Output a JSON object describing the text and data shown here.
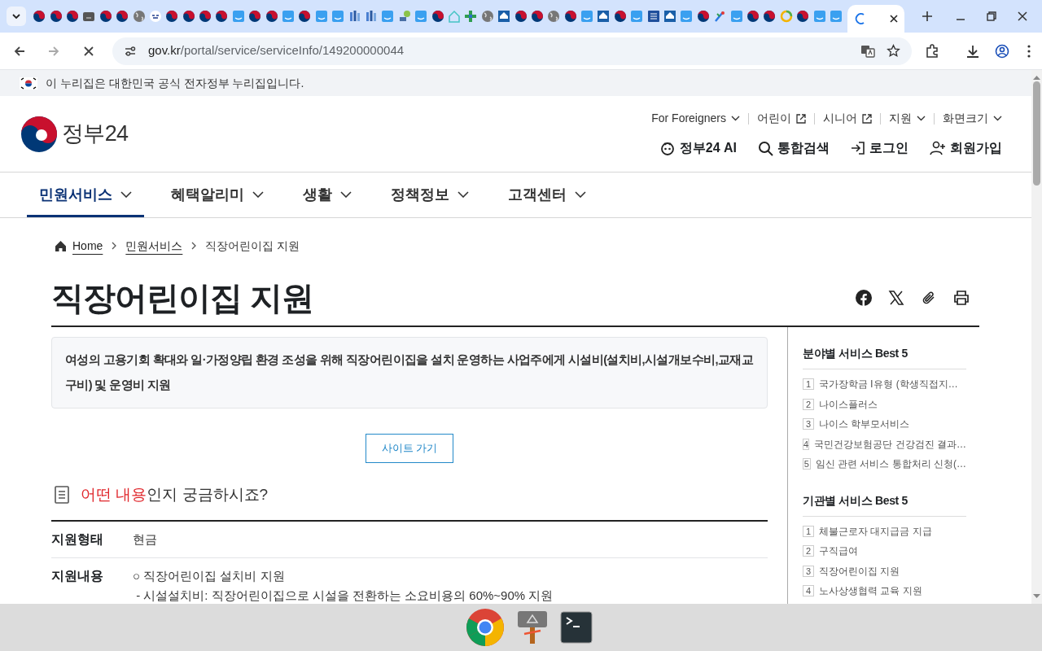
{
  "browser": {
    "tabs": [
      {
        "kind": "taegeuk",
        "selected": false
      },
      {
        "kind": "taegeuk",
        "selected": false
      },
      {
        "kind": "taegeuk",
        "selected": false
      },
      {
        "kind": "folder",
        "selected": false
      },
      {
        "kind": "taegeuk",
        "selected": false
      },
      {
        "kind": "taegeuk",
        "selected": false
      },
      {
        "kind": "globe",
        "selected": false
      },
      {
        "kind": "badge",
        "selected": false
      },
      {
        "kind": "taegeuk",
        "selected": false
      },
      {
        "kind": "taegeuk",
        "selected": false
      },
      {
        "kind": "taegeuk",
        "selected": false
      },
      {
        "kind": "taegeuk",
        "selected": false
      },
      {
        "kind": "blue",
        "selected": false
      },
      {
        "kind": "taegeuk",
        "selected": false
      },
      {
        "kind": "taegeuk",
        "selected": false
      },
      {
        "kind": "blue",
        "selected": false
      },
      {
        "kind": "taegeuk",
        "selected": false
      },
      {
        "kind": "blue",
        "selected": false
      },
      {
        "kind": "blue",
        "selected": false
      },
      {
        "kind": "building",
        "selected": false
      },
      {
        "kind": "building",
        "selected": false
      },
      {
        "kind": "blue",
        "selected": false
      },
      {
        "kind": "leaf",
        "selected": false
      },
      {
        "kind": "blue",
        "selected": false
      },
      {
        "kind": "taegeuk",
        "selected": false
      },
      {
        "kind": "house",
        "selected": false
      },
      {
        "kind": "cross",
        "selected": false
      },
      {
        "kind": "globe",
        "selected": false
      },
      {
        "kind": "home",
        "selected": false
      },
      {
        "kind": "taegeuk",
        "selected": false
      },
      {
        "kind": "taegeuk",
        "selected": false
      },
      {
        "kind": "globe",
        "selected": false
      },
      {
        "kind": "taegeuk",
        "selected": false
      },
      {
        "kind": "blue",
        "selected": false
      },
      {
        "kind": "home",
        "selected": false
      },
      {
        "kind": "taegeuk",
        "selected": false
      },
      {
        "kind": "blue",
        "selected": false
      },
      {
        "kind": "square",
        "selected": false
      },
      {
        "kind": "home",
        "selected": false
      },
      {
        "kind": "blue",
        "selected": false
      },
      {
        "kind": "taegeuk",
        "selected": false
      },
      {
        "kind": "arrow",
        "selected": false
      },
      {
        "kind": "blue",
        "selected": false
      },
      {
        "kind": "taegeuk",
        "selected": false
      },
      {
        "kind": "taegeuk",
        "selected": false
      },
      {
        "kind": "ring",
        "selected": false
      },
      {
        "kind": "taegeuk",
        "selected": false
      },
      {
        "kind": "blue",
        "selected": false
      },
      {
        "kind": "blue",
        "selected": false
      },
      {
        "kind": "spinner",
        "selected": true
      }
    ],
    "url_host": "gov.kr",
    "url_path": "/portal/service/serviceInfo/149200000044"
  },
  "banner": "이 누리집은 대한민국 공식 전자정부 누리집입니다.",
  "header": {
    "logo": "정부24",
    "utility_links": [
      {
        "label": "For Foreigners",
        "kind": "dropdown"
      },
      {
        "label": "어린이",
        "kind": "external"
      },
      {
        "label": "시니어",
        "kind": "external"
      },
      {
        "label": "지원",
        "kind": "dropdown"
      },
      {
        "label": "화면크기",
        "kind": "dropdown"
      }
    ],
    "actions": [
      {
        "label": "정부24 AI",
        "kind": "ai"
      },
      {
        "label": "통합검색",
        "kind": "search"
      },
      {
        "label": "로그인",
        "kind": "login"
      },
      {
        "label": "회원가입",
        "kind": "join"
      }
    ]
  },
  "nav": [
    {
      "label": "민원서비스",
      "selected": true
    },
    {
      "label": "혜택알리미",
      "selected": false
    },
    {
      "label": "생활",
      "selected": false
    },
    {
      "label": "정책정보",
      "selected": false
    },
    {
      "label": "고객센터",
      "selected": false
    }
  ],
  "breadcrumb": [
    {
      "label": "Home",
      "kind": "link"
    },
    {
      "label": "민원서비스",
      "kind": "link"
    },
    {
      "label": "직장어린이집 지원",
      "kind": "current"
    }
  ],
  "title": "직장어린이집 지원",
  "summary": "여성의 고용기회 확대와 일·가정양립 환경 조성을 위해 직장어린이집을 설치 운영하는 사업주에게 시설비(설치비,시설개보수비,교재교구비) 및 운영비 지원",
  "site_button": "사이트 가기",
  "section": {
    "highlight": "어떤 내용",
    "rest": "인지 궁금하시죠?"
  },
  "details": [
    {
      "label": "지원형태",
      "lines": [
        "현금"
      ]
    },
    {
      "label": "지원내용",
      "lines": [
        "○ 직장어린이집 설치비 지원",
        " - 시설설치비: 직장어린이집으로 시설을 전환하는 소요비용의 60%~90% 지원"
      ]
    }
  ],
  "sidebar": [
    {
      "title": "분야별 서비스 Best 5",
      "items": [
        {
          "rank": "1",
          "text": "국가장학금 Ⅰ유형 (학생직접지…"
        },
        {
          "rank": "2",
          "text": "나이스플러스"
        },
        {
          "rank": "3",
          "text": "나이스 학부모서비스"
        },
        {
          "rank": "4",
          "text": "국민건강보험공단 건강검진 결과…"
        },
        {
          "rank": "5",
          "text": "임신 관련 서비스 통합처리 신청(…"
        }
      ]
    },
    {
      "title": "기관별 서비스 Best 5",
      "items": [
        {
          "rank": "1",
          "text": "체불근로자 대지급금 지급"
        },
        {
          "rank": "2",
          "text": "구직급여"
        },
        {
          "rank": "3",
          "text": "직장어린이집 지원"
        },
        {
          "rank": "4",
          "text": "노사상생협력 교육 지원"
        }
      ]
    }
  ]
}
